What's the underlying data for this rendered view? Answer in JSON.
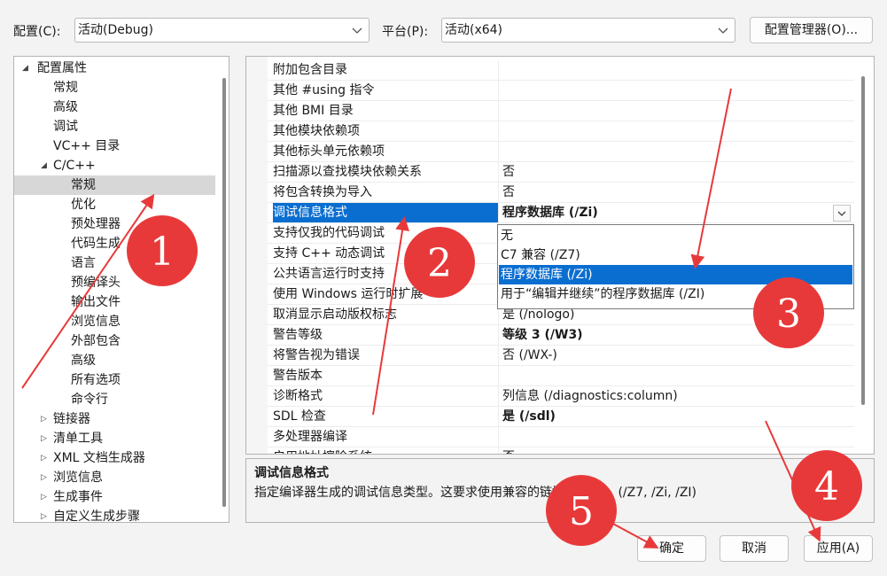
{
  "toolbar": {
    "config_label": "配置(C):",
    "config_value": "活动(Debug)",
    "platform_label": "平台(P):",
    "platform_value": "活动(x64)",
    "config_manager_label": "配置管理器(O)..."
  },
  "tree": {
    "items": [
      {
        "label": "配置属性",
        "twisty": "expanded"
      },
      {
        "label": "常规"
      },
      {
        "label": "高级"
      },
      {
        "label": "调试"
      },
      {
        "label": "VC++ 目录"
      },
      {
        "label": "C/C++",
        "twisty": "expanded"
      },
      {
        "label": "常规",
        "selected": true
      },
      {
        "label": "优化"
      },
      {
        "label": "预处理器"
      },
      {
        "label": "代码生成"
      },
      {
        "label": "语言"
      },
      {
        "label": "预编译头"
      },
      {
        "label": "输出文件"
      },
      {
        "label": "浏览信息"
      },
      {
        "label": "外部包含"
      },
      {
        "label": "高级"
      },
      {
        "label": "所有选项"
      },
      {
        "label": "命令行"
      },
      {
        "label": "链接器",
        "twisty": "collapsed"
      },
      {
        "label": "清单工具",
        "twisty": "collapsed"
      },
      {
        "label": "XML 文档生成器",
        "twisty": "collapsed"
      },
      {
        "label": "浏览信息",
        "twisty": "collapsed"
      },
      {
        "label": "生成事件",
        "twisty": "collapsed"
      },
      {
        "label": "自定义生成步骤",
        "twisty": "collapsed"
      }
    ]
  },
  "grid": {
    "rows": [
      {
        "name": "附加包含目录",
        "value": ""
      },
      {
        "name": "其他 #using 指令",
        "value": ""
      },
      {
        "name": "其他 BMI 目录",
        "value": ""
      },
      {
        "name": "其他模块依赖项",
        "value": ""
      },
      {
        "name": "其他标头单元依赖项",
        "value": ""
      },
      {
        "name": "扫描源以查找模块依赖关系",
        "value": "否"
      },
      {
        "name": "将包含转换为导入",
        "value": "否"
      },
      {
        "name": "调试信息格式",
        "value": "程序数据库 (/Zi)",
        "selected": true
      },
      {
        "name": "支持仅我的代码调试",
        "value": ""
      },
      {
        "name": "支持 C++ 动态调试",
        "value": ""
      },
      {
        "name": "公共语言运行时支持",
        "value": ""
      },
      {
        "name": "使用 Windows 运行时扩展",
        "value": ""
      },
      {
        "name": "取消显示启动版权标志",
        "value": "是 (/nologo)"
      },
      {
        "name": "警告等级",
        "value": "等级 3 (/W3)",
        "bold": true
      },
      {
        "name": "将警告视为错误",
        "value": "否 (/WX-)"
      },
      {
        "name": "警告版本",
        "value": ""
      },
      {
        "name": "诊断格式",
        "value": "列信息 (/diagnostics:column)"
      },
      {
        "name": "SDL 检查",
        "value": "是 (/sdl)",
        "bold": true
      },
      {
        "name": "多处理器编译",
        "value": ""
      },
      {
        "name": "启用地址擦除系统",
        "value": "否"
      }
    ]
  },
  "dropdown": {
    "options": [
      {
        "label": "无"
      },
      {
        "label": "C7 兼容 (/Z7)"
      },
      {
        "label": "程序数据库 (/Zi)",
        "selected": true
      },
      {
        "label": "用于“编辑并继续”的程序数据库 (/ZI)"
      }
    ]
  },
  "description": {
    "title": "调试信息格式",
    "text": "指定编译器生成的调试信息类型。这要求使用兼容的链接器设置。   (/Z7, /Zi, /ZI)"
  },
  "buttons": {
    "ok": "确定",
    "cancel": "取消",
    "apply": "应用(A)"
  },
  "annotations": {
    "color": "#e8393a",
    "labels": [
      "1",
      "2",
      "3",
      "4",
      "5"
    ]
  }
}
